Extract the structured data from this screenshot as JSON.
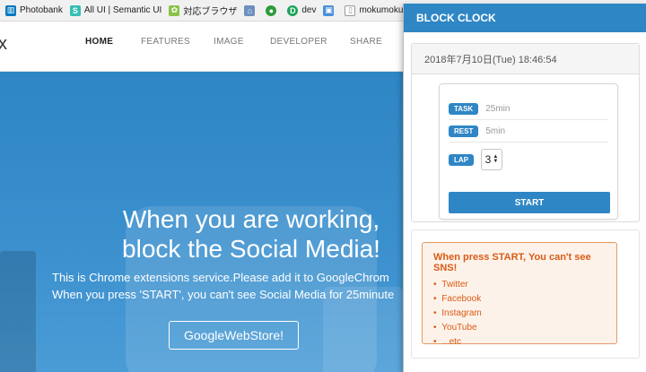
{
  "bookmarks": [
    {
      "label": "Photobank",
      "icon": "trello-icon",
      "color": "#0079bf"
    },
    {
      "label": "All UI | Semantic UI",
      "icon": "semantic-icon",
      "color": "#35bdb2"
    },
    {
      "label": "対応ブラウザ",
      "icon": "browser-icon",
      "color": "#8bc34a"
    },
    {
      "label": "",
      "icon": "home-icon",
      "color": "#6d8fbf"
    },
    {
      "label": "",
      "icon": "green-circle-icon",
      "color": "#2e9a3b"
    },
    {
      "label": "dev",
      "icon": "dev-icon",
      "color": "#1aa35a"
    },
    {
      "label": "",
      "icon": "photo-icon",
      "color": "#4a90d9"
    },
    {
      "label": "mokumoku_LT",
      "icon": "page-icon",
      "color": "#999999"
    },
    {
      "label": "",
      "icon": "flag-icon",
      "color": "#e02020"
    }
  ],
  "nav": {
    "items": [
      "HOME",
      "FEATURES",
      "IMAGE",
      "DEVELOPER",
      "SHARE"
    ],
    "brand_fragment": "x"
  },
  "hero": {
    "title_line1": "When you are working,",
    "title_line2": "block the Social Media!",
    "desc_line1": "This is Chrome extensions service.Please add it to GoogleChrom",
    "desc_line2": "When you press 'START', you can't see Social Media for 25minute",
    "button": "GoogleWebStore!"
  },
  "popup": {
    "title": "BLOCK CLOCK",
    "datetime": "2018年7月10日(Tue)   18:46:54",
    "task_label": "TASK",
    "task_value": "25min",
    "rest_label": "REST",
    "rest_value": "5min",
    "lap_label": "LAP",
    "lap_value": "3",
    "start_label": "START",
    "notice_title": "When press START, You can't see SNS!",
    "sns": [
      "Twitter",
      "Facebook",
      "Instagram",
      "YouTube",
      "...etc"
    ]
  },
  "colors": {
    "accent": "#2f86c5",
    "notice": "#d95b17"
  }
}
